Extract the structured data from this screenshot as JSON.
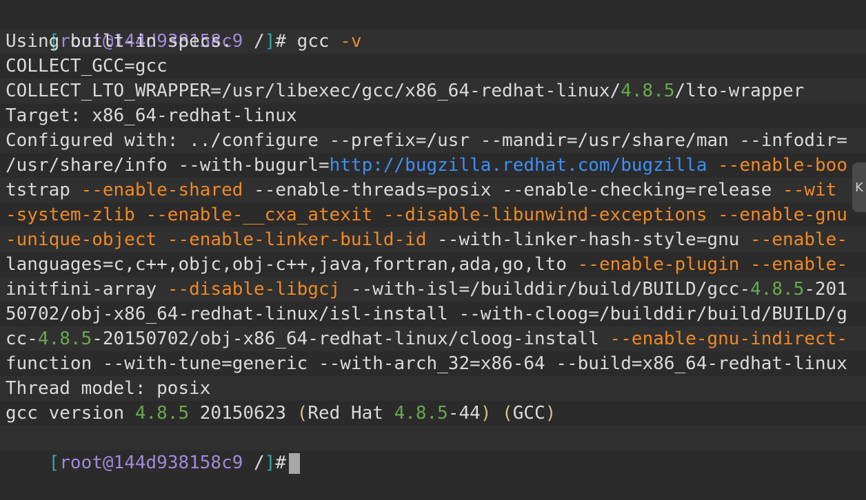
{
  "prompt": {
    "open_bracket": "[",
    "user_host": "root@144d938158c9",
    "path": " /",
    "close_bracket": "]",
    "symbol": "#"
  },
  "command": {
    "name": " gcc ",
    "flag": "-v"
  },
  "output_lines": [
    [
      [
        "Using built-in specs.",
        "text"
      ]
    ],
    [
      [
        "COLLECT_GCC=gcc",
        "text"
      ]
    ],
    [
      [
        "COLLECT_LTO_WRAPPER=/usr/libexec/gcc/x86_64-redhat-linux/",
        "text"
      ],
      [
        "4.8.5",
        "green"
      ],
      [
        "/lto-wrapper",
        "text"
      ]
    ],
    [
      [
        "Target: x86_64-redhat-linux",
        "text"
      ]
    ],
    [
      [
        "Configured with: ../configure --prefix=/usr --mandir=/usr/share/man --infodir=",
        "text"
      ]
    ],
    [
      [
        "/usr/share/info --with-bugurl=",
        "text"
      ],
      [
        "http://bugzilla.redhat.com/bugzilla",
        "blue"
      ],
      [
        " ",
        "text"
      ],
      [
        "--enable-boo",
        "orange"
      ]
    ],
    [
      [
        "tstrap ",
        "text"
      ],
      [
        "--enable-shared",
        "orange"
      ],
      [
        " --enable-threads=posix --enable-checking=release ",
        "text"
      ],
      [
        "--wit",
        "orange"
      ]
    ],
    [
      [
        "-system-zlib --enable-__cxa_atexit --disable-libunwind-exceptions --enable-gnu",
        "orange"
      ]
    ],
    [
      [
        "-unique-object --enable-linker-build-id",
        "orange"
      ],
      [
        " --with-linker-hash-style=gnu ",
        "text"
      ],
      [
        "--enable-",
        "orange"
      ]
    ],
    [
      [
        "languages=c,c++,objc,obj-c++,java,fortran,ada,go,lto ",
        "text"
      ],
      [
        "--enable-plugin --enable-",
        "orange"
      ]
    ],
    [
      [
        "initfini-array ",
        "text"
      ],
      [
        "--disable-libgcj",
        "orange"
      ],
      [
        " --with-isl=/builddir/build/BUILD/gcc-",
        "text"
      ],
      [
        "4.8.5",
        "green"
      ],
      [
        "-201",
        "text"
      ]
    ],
    [
      [
        "50702/obj-x86_64-redhat-linux/isl-install --with-cloog=/builddir/build/BUILD/g",
        "text"
      ]
    ],
    [
      [
        "cc-",
        "text"
      ],
      [
        "4.8.5",
        "green"
      ],
      [
        "-20150702/obj-x86_64-redhat-linux/cloog-install ",
        "text"
      ],
      [
        "--enable-gnu-indirect-",
        "orange"
      ]
    ],
    [
      [
        "function --with-tune=generic --with-arch_32=x86-64 --build=x86_64-redhat-linux",
        "text"
      ]
    ],
    [
      [
        "Thread model: posix",
        "text"
      ]
    ],
    [
      [
        "gcc version ",
        "text"
      ],
      [
        "4.8.5",
        "green"
      ],
      [
        " 20150623 ",
        "text"
      ],
      [
        "(",
        "yellow"
      ],
      [
        "Red Hat ",
        "text"
      ],
      [
        "4.8.5",
        "green"
      ],
      [
        "-44",
        "text"
      ],
      [
        ")",
        "yellow"
      ],
      [
        " ",
        "text"
      ],
      [
        "(",
        "yellow"
      ],
      [
        "GCC",
        "text"
      ],
      [
        ")",
        "yellow"
      ]
    ]
  ],
  "side_handle": {
    "glyph": "K"
  },
  "colors": {
    "background": "#2b2b2b",
    "text": "#dadada",
    "bracket": "#35a6a6",
    "user_host": "#9f8ad9",
    "flag": "#f08a24",
    "version": "#6aa84f",
    "link": "#3f8ff5"
  }
}
